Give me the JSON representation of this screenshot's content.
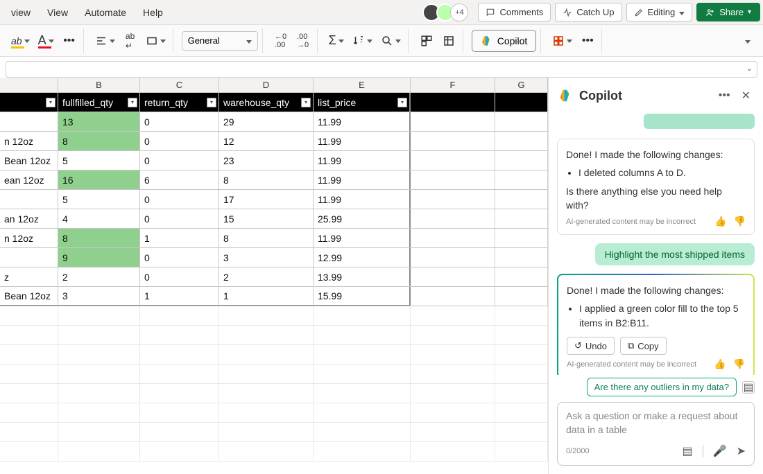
{
  "menu": {
    "items": [
      "view",
      "View",
      "Automate",
      "Help"
    ]
  },
  "topbar": {
    "plus_avatar": "+4",
    "comments": "Comments",
    "catchup": "Catch Up",
    "editing": "Editing",
    "share": "Share"
  },
  "ribbon": {
    "num_format": "General",
    "copilot": "Copilot"
  },
  "columns": [
    "B",
    "C",
    "D",
    "E",
    "F",
    "G"
  ],
  "table": {
    "headers": {
      "a": "",
      "b": "fullfilled_qty",
      "c": "return_qty",
      "d": "warehouse_qty",
      "e": "list_price"
    },
    "rows": [
      {
        "a": "",
        "b": "13",
        "b_hl": true,
        "c": "0",
        "d": "29",
        "e": "11.99"
      },
      {
        "a": "n 12oz",
        "b": "8",
        "b_hl": true,
        "c": "0",
        "d": "12",
        "e": "11.99"
      },
      {
        "a": "Bean 12oz",
        "b": "5",
        "b_hl": false,
        "c": "0",
        "d": "23",
        "e": "11.99"
      },
      {
        "a": "ean 12oz",
        "b": "16",
        "b_hl": true,
        "c": "6",
        "d": "8",
        "e": "11.99"
      },
      {
        "a": "",
        "b": "5",
        "b_hl": false,
        "c": "0",
        "d": "17",
        "e": "11.99"
      },
      {
        "a": "an 12oz",
        "b": "4",
        "b_hl": false,
        "c": "0",
        "d": "15",
        "e": "25.99"
      },
      {
        "a": "n 12oz",
        "b": "8",
        "b_hl": true,
        "c": "1",
        "d": "8",
        "e": "11.99"
      },
      {
        "a": "",
        "b": "9",
        "b_hl": true,
        "c": "0",
        "d": "3",
        "e": "12.99"
      },
      {
        "a": "z",
        "b": "2",
        "b_hl": false,
        "c": "0",
        "d": "2",
        "e": "13.99"
      },
      {
        "a": "Bean 12oz",
        "b": "3",
        "b_hl": false,
        "c": "1",
        "d": "1",
        "e": "15.99"
      }
    ]
  },
  "copilot": {
    "title": "Copilot",
    "msg1": {
      "intro": "Done! I made the following changes:",
      "bullet": "I deleted columns A to D.",
      "follow": "Is there anything else you need help with?",
      "disclaimer": "AI-generated content may be incorrect"
    },
    "user_msg": "Highlight the most shipped items",
    "msg2": {
      "intro": "Done! I made the following changes:",
      "bullet": "I applied a green color fill to the top 5 items in B2:B11.",
      "undo": "Undo",
      "copy": "Copy",
      "disclaimer": "AI-generated content may be incorrect"
    },
    "suggestion": "Are there any outliers in my data?",
    "input_placeholder": "Ask a question or make a request about data in a table",
    "counter": "0/2000"
  }
}
